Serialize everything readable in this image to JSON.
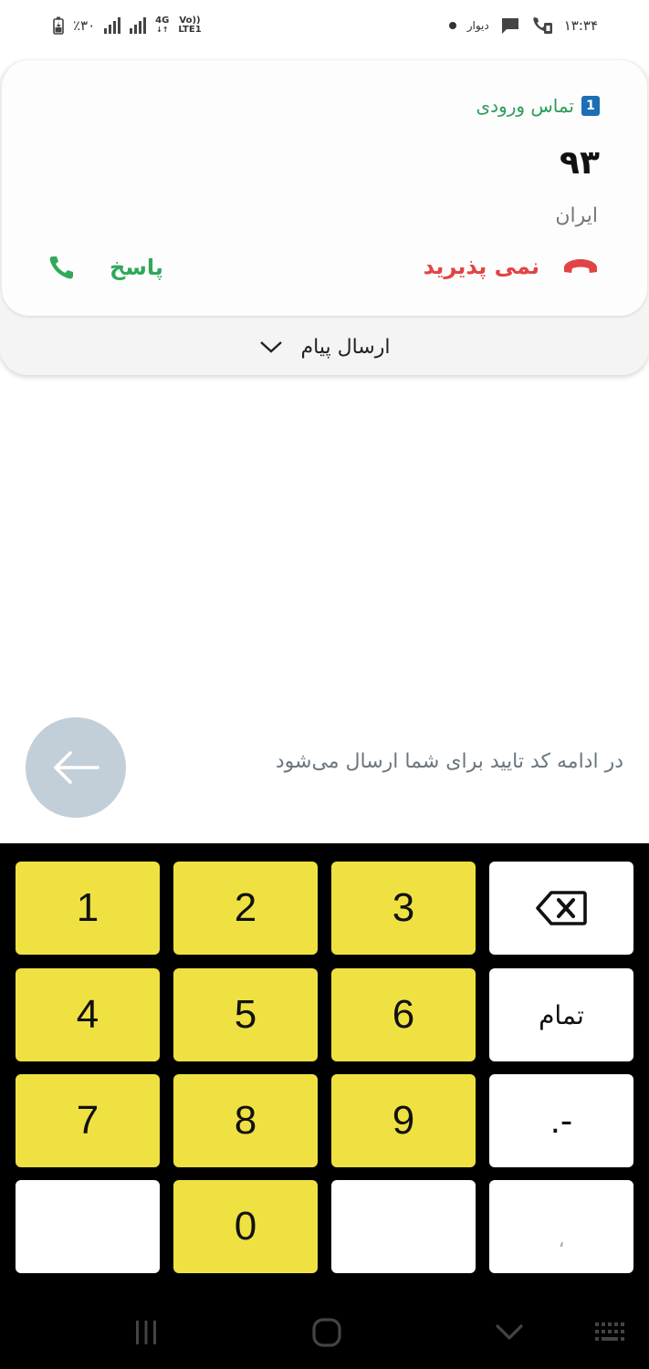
{
  "status_bar": {
    "time": "۱۳:۳۴",
    "app_label": "دیوار",
    "battery": "٪۳۰",
    "network": "4G",
    "volte": "Vo))",
    "lte": "LTE1"
  },
  "call": {
    "header_label": "تماس ورودی",
    "sim_number": "1",
    "caller_number": "۹۳",
    "caller_country": "ایران",
    "answer_label": "پاسخ",
    "decline_label": "نمی پذیرید",
    "send_message_label": "ارسال پیام",
    "colors": {
      "answer": "#2fa95b",
      "decline": "#e24444",
      "header": "#2d9d5a"
    }
  },
  "info": {
    "text": "در ادامه کد تایید برای شما ارسال می‌شود"
  },
  "keyboard": {
    "keys": {
      "k1": "1",
      "k2": "2",
      "k3": "3",
      "k4": "4",
      "k5": "5",
      "k6": "6",
      "k7": "7",
      "k8": "8",
      "k9": "9",
      "k0": "0",
      "done": "تمام",
      "dot_dash": ".-",
      "comma": "،"
    },
    "colors": {
      "digit_key": "#efe142",
      "function_key": "#ffffff",
      "background": "#000000"
    }
  }
}
